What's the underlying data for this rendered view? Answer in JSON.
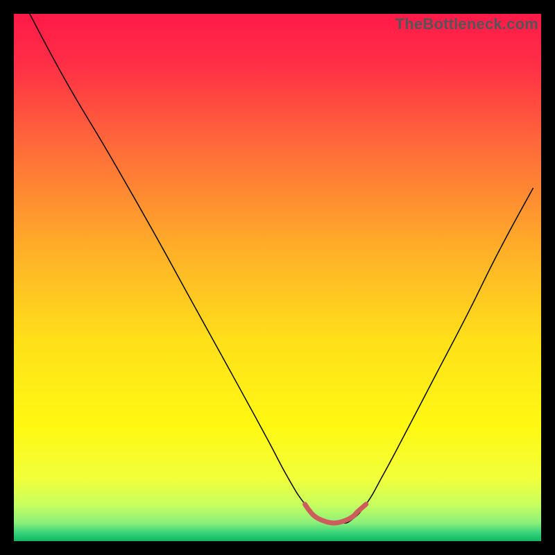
{
  "watermark": {
    "text": "TheBottleneck.com"
  },
  "chart_data": {
    "type": "line",
    "title": "",
    "xlabel": "",
    "ylabel": "",
    "xlim": [
      0,
      100
    ],
    "ylim": [
      0,
      100
    ],
    "grid": false,
    "legend": false,
    "background_gradient": {
      "stops": [
        {
          "pos": 0.0,
          "color": "#ff1a48"
        },
        {
          "pos": 0.1,
          "color": "#ff3046"
        },
        {
          "pos": 0.25,
          "color": "#ff6a3a"
        },
        {
          "pos": 0.45,
          "color": "#ffb028"
        },
        {
          "pos": 0.62,
          "color": "#ffe01a"
        },
        {
          "pos": 0.78,
          "color": "#fff812"
        },
        {
          "pos": 0.88,
          "color": "#f2ff3a"
        },
        {
          "pos": 0.93,
          "color": "#c8ff5e"
        },
        {
          "pos": 0.965,
          "color": "#8cf07a"
        },
        {
          "pos": 0.985,
          "color": "#35d27a"
        },
        {
          "pos": 1.0,
          "color": "#10b760"
        }
      ]
    },
    "series": [
      {
        "name": "bottleneck-curve",
        "color": "#000000",
        "width": 1.5,
        "x": [
          3.0,
          10.0,
          18.0,
          26.0,
          34.0,
          42.0,
          48.0,
          52.0,
          55.2,
          58.0,
          60.0,
          62.0,
          64.0,
          66.8,
          70.0,
          74.0,
          80.0,
          86.0,
          92.0,
          98.5
        ],
        "y": [
          100.0,
          87.0,
          73.5,
          59.5,
          45.0,
          30.5,
          19.5,
          12.0,
          7.0,
          4.0,
          3.4,
          3.4,
          4.0,
          7.0,
          12.5,
          20.0,
          31.5,
          43.0,
          55.0,
          67.0
        ]
      },
      {
        "name": "zero-band-marker",
        "color": "#cd5c5c",
        "width": 7,
        "x": [
          55.2,
          56.2,
          57.2,
          58.6,
          60.0,
          61.4,
          62.8,
          64.2,
          65.2,
          66.0,
          66.8
        ],
        "y": [
          7.0,
          5.6,
          4.6,
          3.9,
          3.5,
          3.5,
          3.9,
          4.6,
          5.6,
          6.3,
          7.0
        ]
      }
    ]
  }
}
